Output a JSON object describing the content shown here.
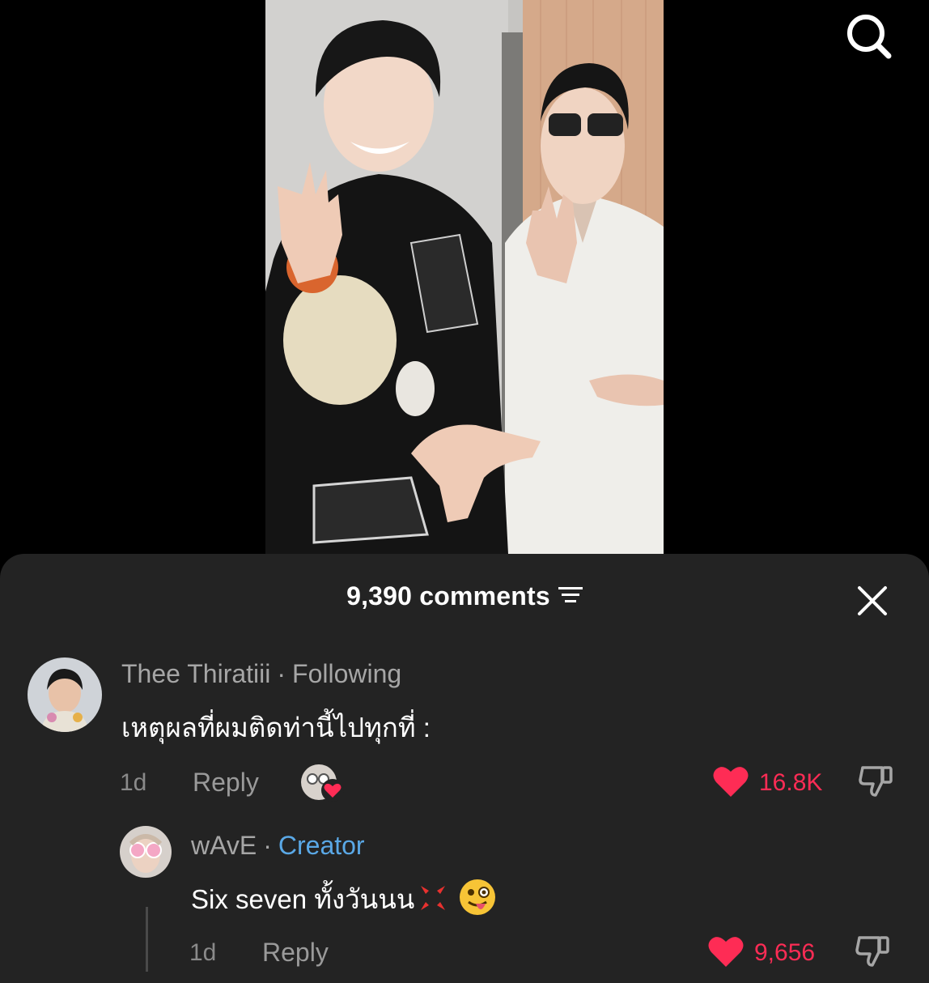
{
  "header": {
    "comment_count": "9,390 comments"
  },
  "comments": [
    {
      "username": "Thee Thiratiii",
      "status": "Following",
      "text": "เหตุผลที่ผมติดท่านี้ไปทุกที่ :",
      "age": "1d",
      "reply_label": "Reply",
      "likes": "16.8K",
      "creator_liked": true
    },
    {
      "username": "wAvE",
      "status": "Creator",
      "text": "Six seven ทั้งวันนน",
      "emojis": [
        "anger-icon",
        "winking-face-with-tongue-icon"
      ],
      "age": "1d",
      "reply_label": "Reply",
      "likes": "9,656"
    }
  ],
  "colors": {
    "sheet_bg": "#232323",
    "like_red": "#fe2c55",
    "creator_blue": "#5aa8e6",
    "muted": "#a6a6a6"
  }
}
